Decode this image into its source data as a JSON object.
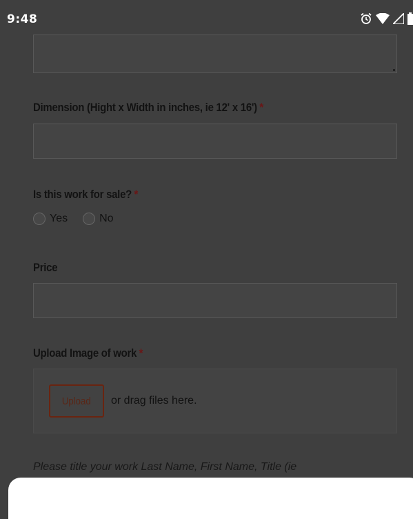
{
  "status_bar": {
    "time": "9:48",
    "icons": [
      "alarm-icon",
      "wifi-icon",
      "cellular-signal-icon",
      "battery-icon"
    ]
  },
  "form": {
    "dimension": {
      "label": "Dimension (Hight x Width in inches, ie 12' x 16')",
      "required_mark": "*",
      "value": ""
    },
    "for_sale": {
      "label": "Is this work for sale?",
      "required_mark": "*",
      "options": [
        "Yes",
        "No"
      ],
      "selected": null
    },
    "price": {
      "label": "Price",
      "value": ""
    },
    "upload": {
      "label": "Upload Image of work",
      "required_mark": "*",
      "button_label": "Upload",
      "hint": "or drag files here."
    },
    "note": "Please title your work Last Name, First Name, Title (ie"
  },
  "colors": {
    "overlay_background": "#3f3f3f",
    "required_accent": "#6a1616",
    "upload_button_border": "#6a2410"
  }
}
